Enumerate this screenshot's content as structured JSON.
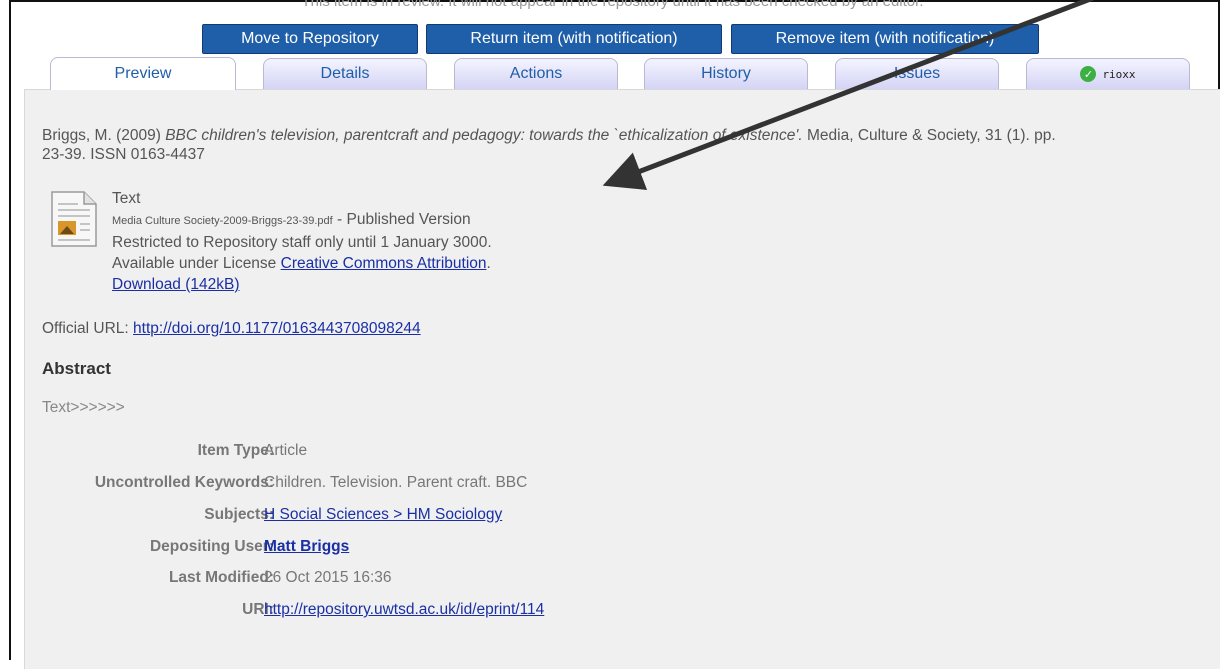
{
  "review_message": "This item is in review. It will not appear in the repository until it has been checked by an editor.",
  "actions": {
    "move": "Move to Repository",
    "return": "Return item (with notification)",
    "remove": "Remove item (with notification)"
  },
  "tabs": {
    "preview": "Preview",
    "details": "Details",
    "actions": "Actions",
    "history": "History",
    "issues": "Issues",
    "rioxx": "rioxx"
  },
  "citation": {
    "authors_year": "Briggs, M. (2009)",
    "title": "BBC children's television, parentcraft and pedagogy: towards the `ethicalization of existence'.",
    "rest_line1": "Media, Culture & Society, 31 (1). pp.",
    "rest_line2": "23-39. ISSN 0163-4437"
  },
  "document": {
    "format": "Text",
    "filename": "Media Culture Society-2009-Briggs-23-39.pdf",
    "version": "Published Version",
    "restriction": "Restricted to Repository staff only until 1 January 3000.",
    "license_prefix": "Available under License",
    "license": "Creative Commons Attribution",
    "download": "Download (142kB)"
  },
  "official_url": {
    "label": "Official URL:",
    "url": "http://doi.org/10.1177/0163443708098244"
  },
  "abstract": {
    "heading": "Abstract",
    "text": "Text>>>>>>"
  },
  "metadata": {
    "item_type": {
      "label": "Item Type:",
      "value": "Article"
    },
    "keywords": {
      "label": "Uncontrolled Keywords:",
      "value": "Children. Television. Parent craft. BBC"
    },
    "subjects": {
      "label": "Subjects:",
      "value": "H Social Sciences > HM Sociology"
    },
    "depositor": {
      "label": "Depositing User:",
      "value": "Matt Briggs"
    },
    "modified": {
      "label": "Last Modified:",
      "value": "26 Oct 2015 16:36"
    },
    "uri": {
      "label": "URI:",
      "value": "http://repository.uwtsd.ac.uk/id/eprint/114"
    }
  },
  "colors": {
    "button_blue": "#1f5ea8",
    "link_blue": "#1a2fa6",
    "panel_bg": "#f0f0f0",
    "rioxx_green": "#3cb043"
  }
}
